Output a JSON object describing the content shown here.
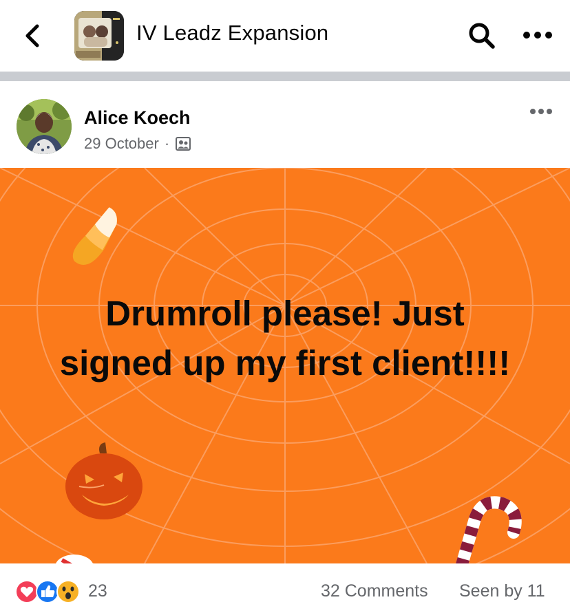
{
  "header": {
    "back_icon": "chevron-left-icon",
    "group_name": "IV Leadz Expansion",
    "search_icon": "search-icon",
    "more_icon": "more-horizontal-icon"
  },
  "post": {
    "author": "Alice Koech",
    "date": "29 October",
    "separator": "·",
    "audience_icon": "group-members-icon",
    "more_icon": "more-horizontal-icon",
    "text": "Drumroll please! Just signed up my first client!!!!",
    "background_color": "#fb7a1b",
    "decorations": [
      "candy-corn",
      "spider-web",
      "jack-o-lantern",
      "candy-cane",
      "peppermint"
    ]
  },
  "footer": {
    "reaction_icons": [
      "love-reaction-icon",
      "like-reaction-icon",
      "wow-reaction-icon"
    ],
    "reaction_count": "23",
    "comments": "32 Comments",
    "seen_by": "Seen by 11"
  }
}
